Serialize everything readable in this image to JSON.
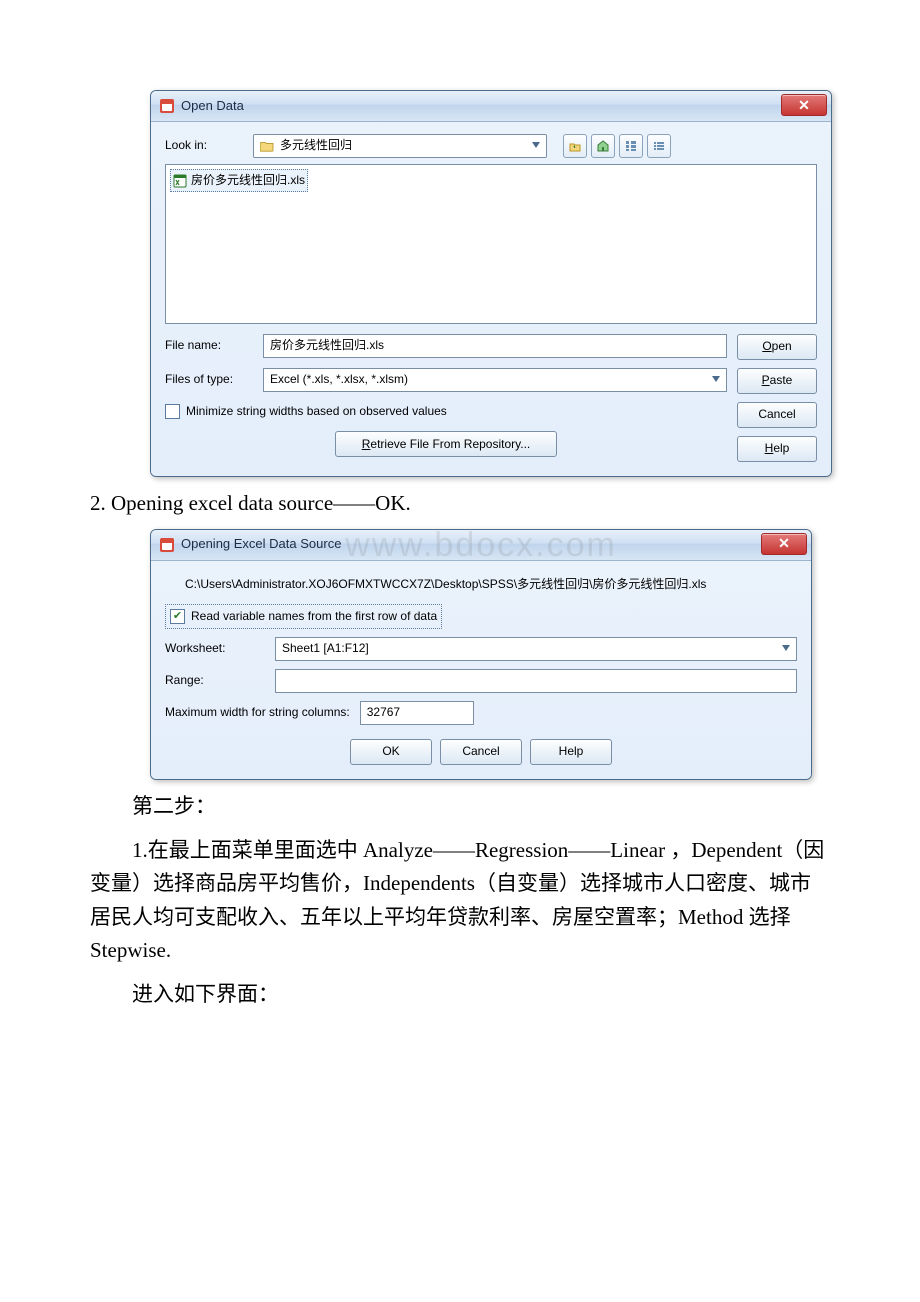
{
  "dialog1": {
    "title": "Open Data",
    "lookin_label": "Look in:",
    "lookin_value": "多元线性回归",
    "file_item": "房价多元线性回归.xls",
    "filename_label": "File name:",
    "filename_value": "房价多元线性回归.xls",
    "filetype_label": "Files of type:",
    "filetype_value": "Excel (*.xls, *.xlsx, *.xlsm)",
    "minimize_label": "Minimize string widths based on observed values",
    "retrieve_label": "Retrieve File From Repository...",
    "open_btn": "Open",
    "paste_btn": "Paste",
    "cancel_btn": "Cancel",
    "help_btn": "Help",
    "icons": {
      "back": "back-icon",
      "up": "up-folder-icon",
      "home": "home-icon",
      "details": "details-view-icon",
      "list": "list-view-icon"
    }
  },
  "caption_step": "2. Opening excel data source——OK.",
  "dialog2": {
    "title": "Opening Excel Data Source",
    "path": "C:\\Users\\Administrator.XOJ6OFMXTWCCX7Z\\Desktop\\SPSS\\多元线性回归\\房价多元线性回归.xls",
    "read_var": "Read variable names from the first row of data",
    "worksheet_label": "Worksheet:",
    "worksheet_value": "Sheet1 [A1:F12]",
    "range_label": "Range:",
    "range_value": "",
    "maxwidth_label": "Maximum width for string columns:",
    "maxwidth_value": "32767",
    "ok": "OK",
    "cancel": "Cancel",
    "help": "Help",
    "watermark": "www.bdocx.com"
  },
  "text_step2_heading": "第二步：",
  "text_step2_body": "1.在最上面菜单里面选中 Analyze——Regression——Linear ，Dependent（因变量）选择商品房平均售价，Independents（自变量）选择城市人口密度、城市居民人均可支配收入、五年以上平均年贷款利率、房屋空置率；Method 选择 Stepwise.",
  "text_step2_last": "进入如下界面："
}
